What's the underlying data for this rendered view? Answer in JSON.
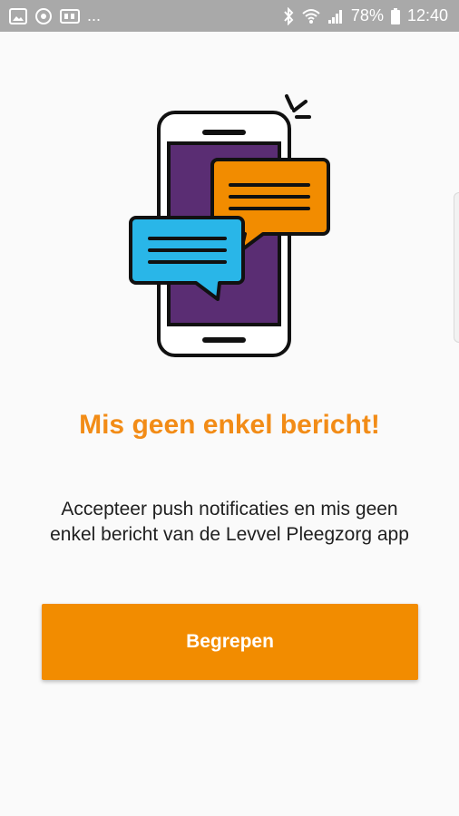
{
  "status_bar": {
    "icons_left": [
      "gallery-icon",
      "sync-icon",
      "media-icon"
    ],
    "overflow": "...",
    "icons_right": [
      "bluetooth-icon",
      "wifi-icon",
      "signal-icon"
    ],
    "battery_percent": "78%",
    "time": "12:40"
  },
  "illustration": {
    "icon": "smartphone-chat-icon",
    "colors": {
      "screen": "#5a2d73",
      "orange_bubble": "#f28c00",
      "blue_bubble": "#29b6e8",
      "outline": "#111111"
    }
  },
  "onboarding": {
    "title": "Mis geen enkel bericht!",
    "body": "Accepteer push notificaties en mis geen enkel bericht van de  Levvel Pleegzorg app",
    "button_label": "Begrepen"
  },
  "colors": {
    "accent": "#f28c00",
    "title": "#f28c17",
    "status_bar": "#a9a9a9",
    "background": "#fafafa"
  }
}
